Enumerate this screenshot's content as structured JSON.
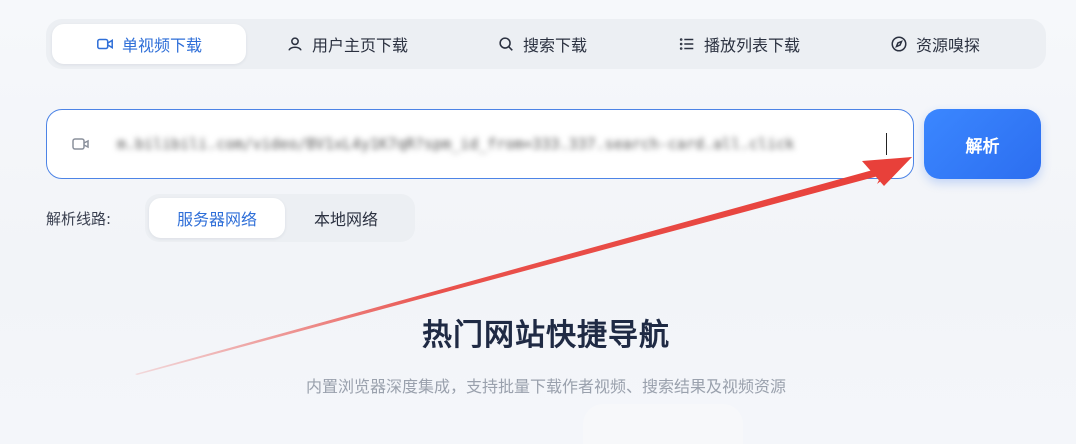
{
  "tabs": [
    {
      "label": "单视频下载",
      "icon": "video-camera-icon",
      "active": true
    },
    {
      "label": "用户主页下载",
      "icon": "user-icon",
      "active": false
    },
    {
      "label": "搜索下载",
      "icon": "search-icon",
      "active": false
    },
    {
      "label": "播放列表下载",
      "icon": "list-icon",
      "active": false
    },
    {
      "label": "资源嗅探",
      "icon": "compass-icon",
      "active": false
    }
  ],
  "url_input": {
    "icon": "video-camera-icon",
    "value": "m.bilibili.com/video/BV1xL4y1K7qR?spm_id_from=333.337.search-card.all.click"
  },
  "parse_button": {
    "label": "解析"
  },
  "route": {
    "label": "解析线路:",
    "options": [
      {
        "label": "服务器网络",
        "active": true
      },
      {
        "label": "本地网络",
        "active": false
      }
    ]
  },
  "section": {
    "title": "热门网站快捷导航",
    "subtitle": "内置浏览器深度集成，支持批量下载作者视频、搜索结果及视频资源"
  },
  "colors": {
    "accent": "#2f6fd8",
    "button": "#2c6ef0",
    "annotation": "#e8403a"
  }
}
